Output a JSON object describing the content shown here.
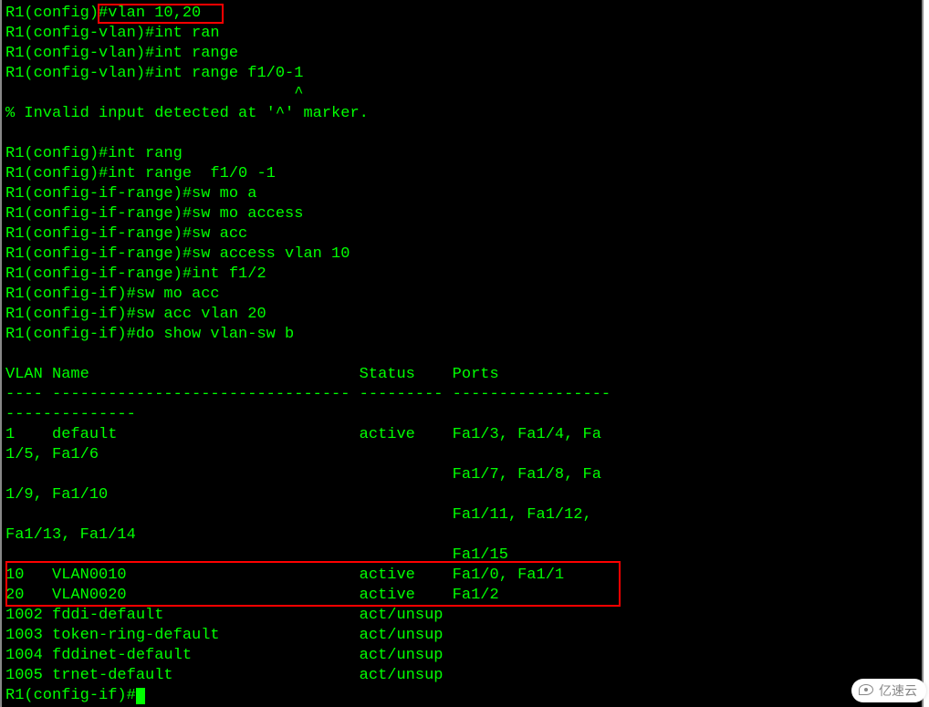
{
  "terminal": {
    "lines": [
      "R1(config)#vlan 10,20",
      "R1(config-vlan)#int ran",
      "R1(config-vlan)#int range",
      "R1(config-vlan)#int range f1/0-1",
      "                               ^",
      "% Invalid input detected at '^' marker.",
      "",
      "R1(config)#int rang",
      "R1(config)#int range  f1/0 -1",
      "R1(config-if-range)#sw mo a",
      "R1(config-if-range)#sw mo access",
      "R1(config-if-range)#sw acc",
      "R1(config-if-range)#sw access vlan 10",
      "R1(config-if-range)#int f1/2",
      "R1(config-if)#sw mo acc",
      "R1(config-if)#sw acc vlan 20",
      "R1(config-if)#do show vlan-sw b",
      "",
      "VLAN Name                             Status    Ports",
      "---- -------------------------------- --------- -----------------",
      "--------------",
      "1    default                          active    Fa1/3, Fa1/4, Fa",
      "1/5, Fa1/6",
      "                                                Fa1/7, Fa1/8, Fa",
      "1/9, Fa1/10",
      "                                                Fa1/11, Fa1/12, ",
      "Fa1/13, Fa1/14",
      "                                                Fa1/15",
      "10   VLAN0010                         active    Fa1/0, Fa1/1",
      "20   VLAN0020                         active    Fa1/2",
      "1002 fddi-default                     act/unsup",
      "1003 token-ring-default               act/unsup",
      "1004 fddinet-default                  act/unsup",
      "1005 trnet-default                    act/unsup"
    ],
    "prompt": "R1(config-if)#"
  },
  "highlights": {
    "box1_target": "#vlan 10,20",
    "box2_target": "VLAN0010/VLAN0020 rows"
  },
  "watermark": {
    "text": "亿速云"
  },
  "chart_data": {
    "type": "table",
    "title": "VLAN Switch Brief",
    "columns": [
      "VLAN",
      "Name",
      "Status",
      "Ports"
    ],
    "rows": [
      {
        "VLAN": 1,
        "Name": "default",
        "Status": "active",
        "Ports": "Fa1/3, Fa1/4, Fa1/5, Fa1/6, Fa1/7, Fa1/8, Fa1/9, Fa1/10, Fa1/11, Fa1/12, Fa1/13, Fa1/14, Fa1/15"
      },
      {
        "VLAN": 10,
        "Name": "VLAN0010",
        "Status": "active",
        "Ports": "Fa1/0, Fa1/1"
      },
      {
        "VLAN": 20,
        "Name": "VLAN0020",
        "Status": "active",
        "Ports": "Fa1/2"
      },
      {
        "VLAN": 1002,
        "Name": "fddi-default",
        "Status": "act/unsup",
        "Ports": ""
      },
      {
        "VLAN": 1003,
        "Name": "token-ring-default",
        "Status": "act/unsup",
        "Ports": ""
      },
      {
        "VLAN": 1004,
        "Name": "fddinet-default",
        "Status": "act/unsup",
        "Ports": ""
      },
      {
        "VLAN": 1005,
        "Name": "trnet-default",
        "Status": "act/unsup",
        "Ports": ""
      }
    ]
  }
}
